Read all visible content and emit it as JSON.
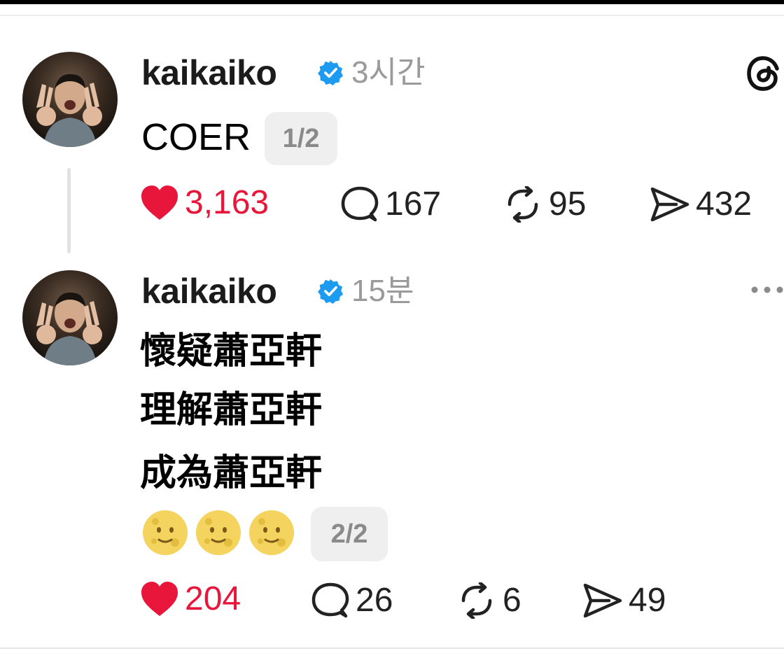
{
  "posts": [
    {
      "username": "kaikaiko",
      "time": "3시간",
      "text": "COER",
      "page_badge": "1/2",
      "likes": "3,163",
      "replies": "167",
      "reposts": "95",
      "shares": "432",
      "liked": true
    },
    {
      "username": "kaikaiko",
      "time": "15분",
      "lines": [
        "懷疑蕭亞軒",
        "理解蕭亞軒",
        "成為蕭亞軒"
      ],
      "emojis": [
        "full-moon-face",
        "full-moon-face",
        "full-moon-face"
      ],
      "page_badge": "2/2",
      "likes": "204",
      "replies": "26",
      "reposts": "6",
      "shares": "49",
      "liked": true
    }
  ],
  "icons": {
    "verified": "verified-badge-icon",
    "heart": "heart-icon",
    "reply": "reply-bubble-icon",
    "repost": "repost-icon",
    "share": "send-icon",
    "app": "threads-logo-icon",
    "more": "more-dots-icon"
  },
  "colors": {
    "like": "#e8163a",
    "verified": "#1d9bf0",
    "muted": "#9a9a9a",
    "badge_bg": "#efefef"
  }
}
